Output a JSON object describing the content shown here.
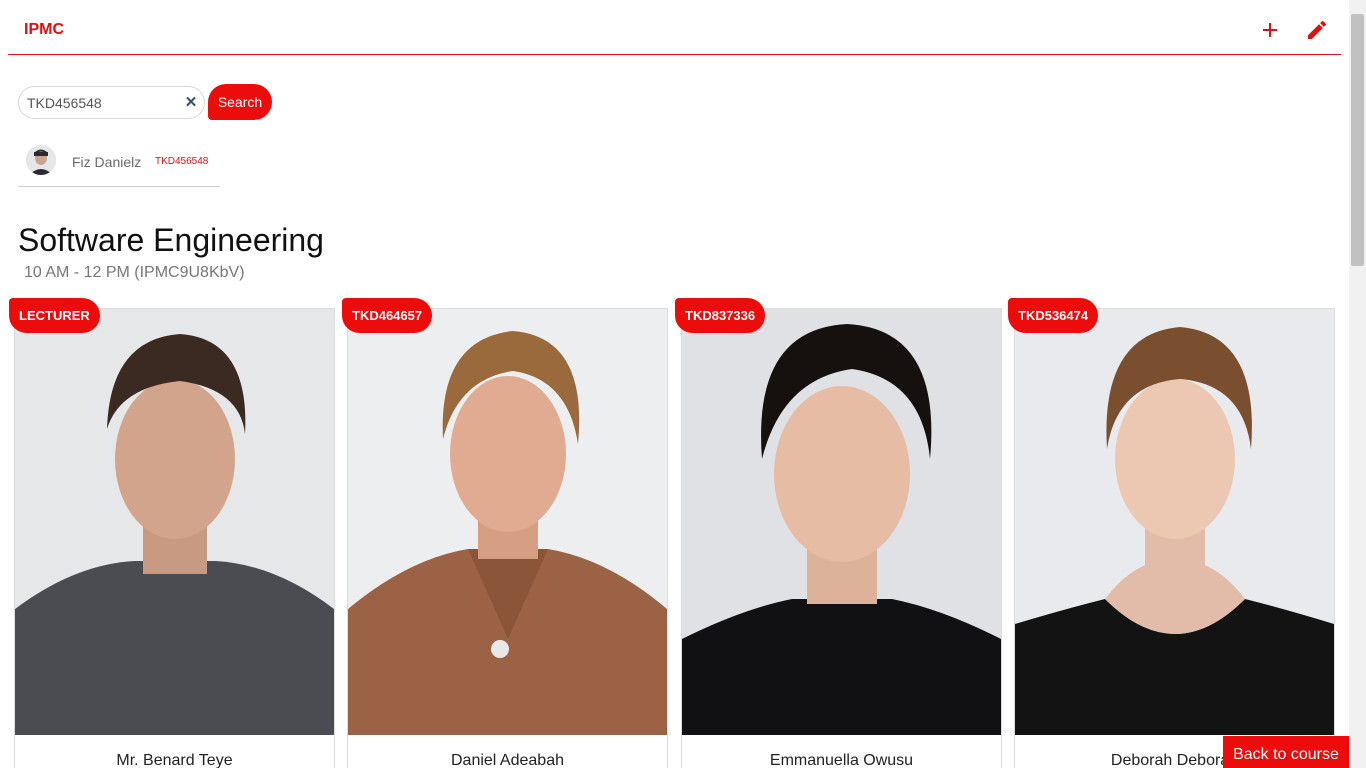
{
  "navbar": {
    "brand": "IPMC",
    "add_icon": "plus-icon",
    "edit_icon": "pencil-icon",
    "accent_color": "#e01010"
  },
  "search": {
    "value": "TKD456548",
    "clear_icon": "close-icon",
    "button_label": "Search"
  },
  "result": {
    "name": "Fiz Danielz",
    "code": "TKD456548"
  },
  "course": {
    "title": "Software Engineering",
    "time": "10 AM - 12 PM (IPMC9U8KbV)"
  },
  "cards": [
    {
      "badge": "LECTURER",
      "name": "Mr. Benard Teye"
    },
    {
      "badge": "TKD464657",
      "name": "Daniel Adeabah"
    },
    {
      "badge": "TKD837336",
      "name": "Emmanuella Owusu"
    },
    {
      "badge": "TKD536474",
      "name": "Deborah Deborah"
    }
  ],
  "back_button": {
    "label": "Back to course"
  }
}
